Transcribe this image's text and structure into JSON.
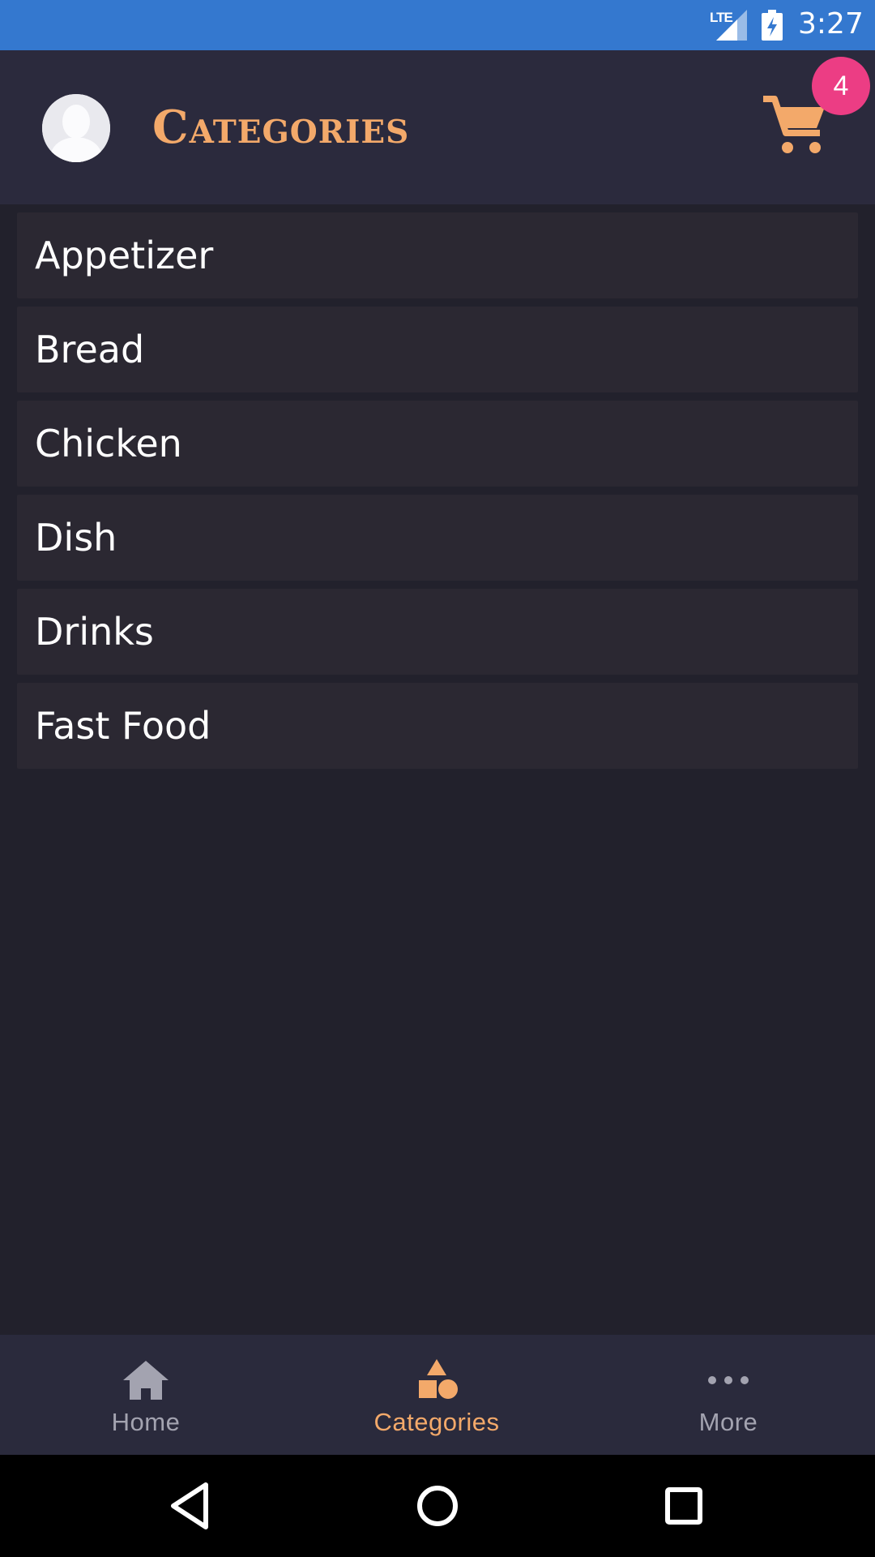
{
  "status_bar": {
    "network": "LTE",
    "time": "3:27",
    "icons": [
      "signal-icon",
      "battery-charging-icon"
    ]
  },
  "header": {
    "title": "Categories",
    "avatar_icon": "user-avatar-icon",
    "cart_icon": "shopping-cart-icon",
    "cart_count": "4"
  },
  "categories": [
    {
      "label": "Appetizer"
    },
    {
      "label": "Bread"
    },
    {
      "label": "Chicken"
    },
    {
      "label": "Dish"
    },
    {
      "label": "Drinks"
    },
    {
      "label": "Fast Food"
    }
  ],
  "bottom_nav": {
    "items": [
      {
        "label": "Home",
        "icon": "home-icon",
        "active": false
      },
      {
        "label": "Categories",
        "icon": "shapes-icon",
        "active": true
      },
      {
        "label": "More",
        "icon": "more-horizontal-icon",
        "active": false
      }
    ]
  },
  "system_nav": [
    "back-icon",
    "home-circle-icon",
    "recents-icon"
  ],
  "colors": {
    "status_bar": "#3478cf",
    "app_bar": "#2b2a3d",
    "background": "#22212c",
    "list_item": "#2b2832",
    "accent": "#f3a96a",
    "badge": "#ec3d84",
    "inactive": "#a3a3b0"
  }
}
